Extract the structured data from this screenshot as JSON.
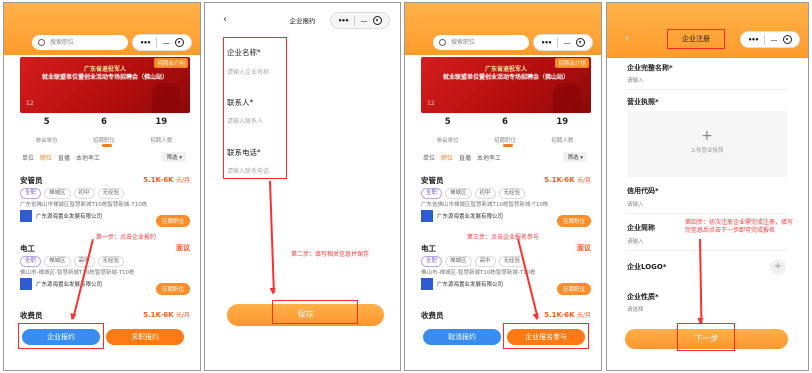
{
  "panel1": {
    "search_placeholder": "搜索职位",
    "banner_tag": "招聘会介绍",
    "banner_line1": "广东省退役军人",
    "banner_line2": "就业联盟单位暨创业活动专场招聘会（佛山站）",
    "banner_num": "12",
    "stats": [
      {
        "value": "5",
        "label": "参会单位"
      },
      {
        "value": "6",
        "label": "招聘职位"
      },
      {
        "value": "19",
        "label": "招聘人数"
      }
    ],
    "tabs": [
      "单位",
      "职位",
      "直播",
      "本地率工"
    ],
    "filter": "筛选 ▾",
    "jobs": [
      {
        "title": "安管员",
        "salary": "5.1K-6K",
        "unit": "元/月",
        "chips": [
          "全职",
          "禅城区",
          "初中",
          "无经验"
        ],
        "address": "广东省佛山市禅城区智慧新城T10栋智慧新城-T10栋",
        "company": "广东源海置业发展有限公司",
        "apply": "应聘职位"
      },
      {
        "title": "电工",
        "salary": "面议",
        "unit": "",
        "chips": [
          "全职",
          "禅城区",
          "高中",
          "无经验"
        ],
        "address": "佛山市-禅城区-智慧新城T10栋智慧新城-T10栋",
        "company": "广东源海置业发展有限公司",
        "apply": "应聘职位"
      },
      {
        "title": "收费员",
        "salary": "5.1K-6K",
        "unit": "元/月"
      }
    ],
    "btn_left": "企业报约",
    "btn_right": "求职报约",
    "step_note": "第一步：点击企业报约"
  },
  "panel2": {
    "title": "企业报约",
    "fields": [
      {
        "label": "企业名称*",
        "placeholder": "请输入企业名称"
      },
      {
        "label": "联系人*",
        "placeholder": "请输入联系人"
      },
      {
        "label": "联系电话*",
        "placeholder": "请输入联系电话"
      }
    ],
    "submit": "保存",
    "step_note": "第二步：填写相关信息并保存"
  },
  "panel3": {
    "btn_left": "取消报约",
    "btn_right": "企业报名参与",
    "step_note": "第三步：点击企业报名参与"
  },
  "panel4": {
    "title": "企业注册",
    "fields": [
      {
        "label": "企业完整名称*",
        "placeholder": "请输入"
      },
      {
        "label": "营业执照*",
        "placeholder": ""
      },
      {
        "label": "信用代码*",
        "placeholder": "请输入"
      },
      {
        "label": "企业简称",
        "placeholder": "请输入"
      },
      {
        "label": "企业LOGO*",
        "placeholder": ""
      },
      {
        "label": "企业性质*",
        "placeholder": "请选择"
      }
    ],
    "upload_text": "上传营业执照",
    "next": "下一步",
    "step_note": "第四步：初次注册企业需完成注册，填写完信息后点击下一步即可完成报名"
  },
  "capsule_dots": "•••",
  "accent": "#ff8e2a",
  "annotation_color": "#ff2b2b"
}
